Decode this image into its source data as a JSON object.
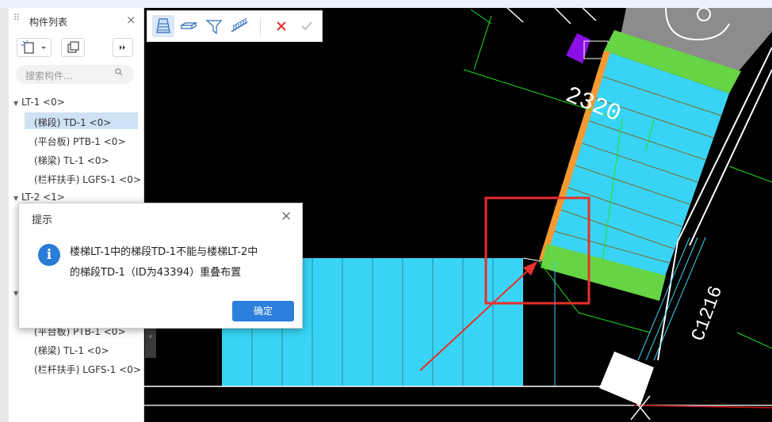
{
  "panel": {
    "title": "构件列表",
    "search_placeholder": "搜索构件...",
    "tree": [
      {
        "label": "LT-1 <0>",
        "level": 0
      },
      {
        "label": "(梯段) TD-1 <0>",
        "level": 1,
        "selected": true
      },
      {
        "label": "(平台板) PTB-1 <0>",
        "level": 1
      },
      {
        "label": "(梯梁) TL-1 <0>",
        "level": 1
      },
      {
        "label": "(栏杆扶手) LGFS-1 <0>",
        "level": 1
      },
      {
        "label": "LT-2 <1>",
        "level": 0
      },
      {
        "label": "(平台板) PTB-1 <0>",
        "level": 1
      },
      {
        "label": "(梯梁) TL-1 <0>",
        "level": 1
      },
      {
        "label": "(栏杆扶手) LGFS-1 <0>",
        "level": 1
      }
    ]
  },
  "toolbar": {
    "icons": [
      "stair-segment-icon",
      "platform-slab-icon",
      "stair-beam-icon",
      "railing-icon"
    ],
    "cancel_icon": "cross-icon",
    "confirm_icon": "check-icon"
  },
  "canvas": {
    "dimension_text": "2320",
    "window_label": "C1216"
  },
  "dialog": {
    "title": "提示",
    "message_line1": "楼梯LT-1中的梯段TD-1不能与楼梯LT-2中",
    "message_line2": "的梯段TD-1（ID为43394）重叠布置",
    "ok_label": "确定"
  },
  "colors": {
    "stair_fill": "#39d4f5",
    "landing_green": "#66d444",
    "highlight_red": "#e8302c",
    "accent_blue": "#2d7fdc",
    "orange_edge": "#f59a32",
    "purple_block": "#8a10e6"
  }
}
